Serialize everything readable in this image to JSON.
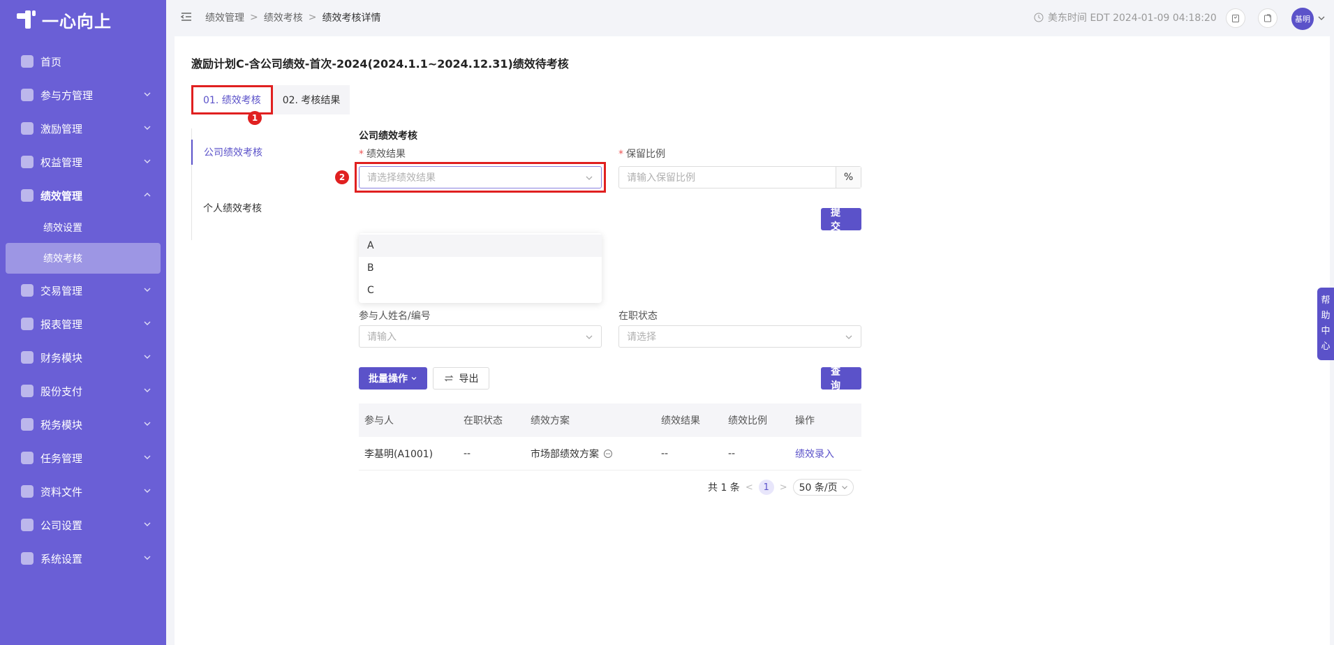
{
  "app": {
    "logo_text": "一心向上"
  },
  "sidebar": {
    "items": [
      {
        "label": "首页",
        "icon": "home-icon",
        "has_chevron": false
      },
      {
        "label": "参与方管理",
        "icon": "participants-icon",
        "has_chevron": true
      },
      {
        "label": "激励管理",
        "icon": "incentive-icon",
        "has_chevron": true
      },
      {
        "label": "权益管理",
        "icon": "equity-icon",
        "has_chevron": true
      },
      {
        "label": "绩效管理",
        "icon": "crown-icon",
        "has_chevron": true,
        "expanded": true
      },
      {
        "label": "交易管理",
        "icon": "trade-icon",
        "has_chevron": true
      },
      {
        "label": "报表管理",
        "icon": "report-icon",
        "has_chevron": true
      },
      {
        "label": "财务模块",
        "icon": "finance-icon",
        "has_chevron": true
      },
      {
        "label": "股份支付",
        "icon": "share-payment-icon",
        "has_chevron": true
      },
      {
        "label": "税务模块",
        "icon": "tax-icon",
        "has_chevron": true
      },
      {
        "label": "任务管理",
        "icon": "task-icon",
        "has_chevron": true
      },
      {
        "label": "资料文件",
        "icon": "folder-icon",
        "has_chevron": true
      },
      {
        "label": "公司设置",
        "icon": "company-icon",
        "has_chevron": true
      },
      {
        "label": "系统设置",
        "icon": "settings-icon",
        "has_chevron": true
      }
    ],
    "subitems": [
      {
        "label": "绩效设置"
      },
      {
        "label": "绩效考核",
        "active": true
      }
    ]
  },
  "header": {
    "breadcrumb": [
      "绩效管理",
      "绩效考核",
      "绩效考核详情"
    ],
    "time_label": "美东时间 EDT 2024-01-09 04:18:20",
    "avatar_text": "基明"
  },
  "page": {
    "title": "激励计划C-含公司绩效-首次-2024(2024.1.1~2024.12.31)绩效待考核",
    "tabs": [
      {
        "label": "01. 绩效考核",
        "active": true
      },
      {
        "label": "02. 考核结果",
        "active": false
      }
    ],
    "markers": [
      "1",
      "2"
    ],
    "side_nav": [
      {
        "label": "公司绩效考核",
        "active": true
      },
      {
        "label": "个人绩效考核",
        "active": false
      }
    ]
  },
  "company_form": {
    "section_title": "公司绩效考核",
    "result_label": "绩效结果",
    "result_placeholder": "请选择绩效结果",
    "ratio_label": "保留比例",
    "ratio_placeholder": "请输入保留比例",
    "ratio_suffix": "%",
    "submit_label": "提 交",
    "dropdown_options": [
      "A",
      "B",
      "C"
    ]
  },
  "personal_form": {
    "name_label": "参与人姓名/编号",
    "name_placeholder": "请输入",
    "status_label": "在职状态",
    "status_placeholder": "请选择",
    "query_label": "查 询",
    "batch_label": "批量操作",
    "export_label": "导出"
  },
  "table": {
    "headers": [
      "参与人",
      "在职状态",
      "绩效方案",
      "绩效结果",
      "绩效比例",
      "操作"
    ],
    "rows": [
      {
        "participant": "李基明(A1001)",
        "status": "--",
        "plan": "市场部绩效方案",
        "result": "--",
        "ratio": "--",
        "action": "绩效录入"
      }
    ]
  },
  "pagination": {
    "total_text": "共 1 条",
    "current_page": "1",
    "page_size": "50 条/页"
  },
  "help": {
    "chars": [
      "帮",
      "助",
      "中",
      "心"
    ]
  },
  "colors": {
    "primary": "#5b52c9",
    "sidebar": "#6a5fd6",
    "highlight": "#e02020"
  }
}
